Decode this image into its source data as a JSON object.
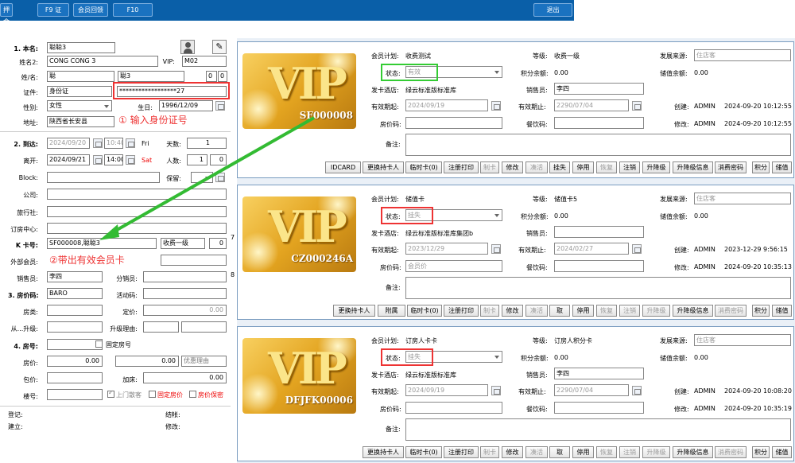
{
  "toolbar": {
    "btn1": "押金",
    "btn2": "F9 证",
    "btn3": "会员回馈",
    "btn4": "F10",
    "exit": "退出"
  },
  "left": {
    "name_label": "1. 本名:",
    "name_val": "聪聪3",
    "name2_label": "姓名2:",
    "name2_val": "CONG CONG 3",
    "vip_label": "VIP:",
    "vip_val": "M02",
    "surname_label": "姓/名:",
    "surname_val": "聪",
    "given_val": "聪3",
    "n1": "0",
    "n2": "0",
    "id_label": "证件:",
    "id_type": "身份证",
    "id_no": "******************27",
    "sex_label": "性别:",
    "sex_val": "女性",
    "birth_label": "生日:",
    "birth_val": "1996/12/09",
    "addr_label": "地址:",
    "addr_val": "陕西省长安县",
    "arrive_label": "2. 到达:",
    "arrive_date": "2024/09/20",
    "arrive_time": "10:40",
    "arrive_dow": "Fri",
    "days_label": "天数:",
    "days_val": "1",
    "leave_label": "离开:",
    "leave_date": "2024/09/21",
    "leave_time": "14:00",
    "leave_dow": "Sat",
    "people_label": "人数:",
    "people_val": "1",
    "people_val2": "0",
    "block_label": "Block:",
    "keep_label": "保留:",
    "company_label": "公司:",
    "agent_label": "旅行社:",
    "center_label": "订房中心:",
    "kcard_label": "K 卡号:",
    "kcard_val": "SF000008,聪聪3",
    "kcard_type": "收费一级",
    "kcard_n": "0",
    "ext_label": "外部会员:",
    "sales_label": "销售员:",
    "sales_val": "李四",
    "sub_label": "分销员:",
    "rate_label": "3. 房价码:",
    "rate_val": "BARO",
    "act_label": "活动码:",
    "rtype_label": "房类:",
    "price_label": "定价:",
    "price_val": "0.00",
    "from_label": "从...升级:",
    "upg_label": "升级理由:",
    "room_label": "4. 房号:",
    "fix_label": "固定房号",
    "rprice_label": "房价:",
    "rprice_val": "0.00",
    "rprice2": "0.00",
    "disc_label": "优惠理由",
    "pkg_label": "包价:",
    "add_label": "加床:",
    "add_val": "0.00",
    "stay_label": "楼号:",
    "door_label": "上门散客",
    "fixprice_label": "固定房价",
    "secret_label": "房价保密",
    "reg_label": "登记:",
    "settle_label": "结帐:",
    "create_label": "建立:",
    "modify_label": "修改:",
    "side7": "7",
    "side8": "8"
  },
  "annot": {
    "a1": "① 输入身份证号",
    "a2": "②带出有效会员卡"
  },
  "panels": [
    {
      "card_no": "SF000008",
      "plan_label": "会员计划:",
      "plan_val": "收费测试",
      "level_label": "等级:",
      "level_val": "收费一级",
      "src_label": "发展来源:",
      "src_val": "住店客",
      "status_label": "状态:",
      "status_val": "有效",
      "points_label": "积分余额:",
      "points_val": "0.00",
      "stored_label": "储值余额:",
      "stored_val": "0.00",
      "hotel_label": "发卡酒店:",
      "hotel_val": "绿云标准版标准库",
      "sales_label": "销售员:",
      "sales_val": "李四",
      "from_label": "有效期起:",
      "from_val": "2024/09/19",
      "to_label": "有效期止:",
      "to_val": "2290/07/04",
      "created_label": "创建:",
      "created_user": "ADMIN",
      "created_at": "2024-09-20 10:12:55",
      "room_label": "房价码:",
      "room_val": "",
      "meal_label": "餐饮码:",
      "modified_label": "修改:",
      "modified_user": "ADMIN",
      "modified_at": "2024-09-20 10:12:55",
      "note_label": "备注:",
      "buttons": [
        "IDCARD",
        "更换持卡人",
        "临时卡(0)",
        "注册打印",
        "制卡",
        "修改",
        "凑活",
        "挂失",
        "停用",
        "恢复",
        "注销",
        "升降级",
        "升降级信息",
        "消费密码",
        "积分",
        "储值"
      ],
      "disabled": [
        4,
        6,
        9
      ]
    },
    {
      "card_no": "CZ000246A",
      "plan_label": "会员计划:",
      "plan_val": "储值卡",
      "level_label": "等级:",
      "level_val": "储值卡5",
      "src_label": "发展来源:",
      "src_val": "住店客",
      "status_label": "状态:",
      "status_val": "挂失",
      "points_label": "积分余额:",
      "points_val": "0.00",
      "stored_label": "储值余额:",
      "stored_val": "0.00",
      "hotel_label": "发卡酒店:",
      "hotel_val": "绿云标准版标准库集团b",
      "sales_label": "销售员:",
      "sales_val": "",
      "from_label": "有效期起:",
      "from_val": "2023/12/29",
      "to_label": "有效期止:",
      "to_val": "2024/02/27",
      "created_label": "创建:",
      "created_user": "ADMIN",
      "created_at": "2023-12-29 9:56:15",
      "room_label": "房价码:",
      "room_val": "会员价",
      "meal_label": "餐饮码:",
      "modified_label": "修改:",
      "modified_user": "ADMIN",
      "modified_at": "2024-09-20 10:35:13",
      "note_label": "备注:",
      "buttons": [
        "更换持卡人",
        "附属",
        "临时卡(0)",
        "注册打印",
        "制卡",
        "修改",
        "凑活",
        "取",
        "停用",
        "恢复",
        "注销",
        "升降级",
        "升降级信息",
        "消费密码",
        "积分",
        "储值"
      ],
      "disabled": [
        4,
        6,
        9,
        10,
        11,
        13
      ]
    },
    {
      "card_no": "DFJFK00006",
      "plan_label": "会员计划:",
      "plan_val": "订房人卡卡",
      "level_label": "等级:",
      "level_val": "订房人积分卡",
      "src_label": "发展来源:",
      "src_val": "住店客",
      "status_label": "状态:",
      "status_val": "挂失",
      "points_label": "积分余额:",
      "points_val": "0.00",
      "stored_label": "储值余额:",
      "stored_val": "0.00",
      "hotel_label": "发卡酒店:",
      "hotel_val": "绿云标准版标准库",
      "sales_label": "销售员:",
      "sales_val": "李四",
      "from_label": "有效期起:",
      "from_val": "2024/09/19",
      "to_label": "有效期止:",
      "to_val": "2290/07/04",
      "created_label": "创建:",
      "created_user": "ADMIN",
      "created_at": "2024-09-20 10:08:20",
      "room_label": "房价码:",
      "room_val": "",
      "meal_label": "餐饮码:",
      "modified_label": "修改:",
      "modified_user": "ADMIN",
      "modified_at": "2024-09-20 10:35:19",
      "note_label": "备注:",
      "buttons": [
        "更换持卡人",
        "临时卡(0)",
        "注册打印",
        "制卡",
        "修改",
        "凑活",
        "取",
        "停用",
        "恢复",
        "注销",
        "升降级",
        "升降级信息",
        "消费密码",
        "积分",
        "储值"
      ],
      "disabled": [
        3,
        5,
        8,
        9,
        10,
        12
      ]
    }
  ],
  "colors": {
    "toolbar": "#0a5fa8",
    "annot": "#e33333",
    "arrow": "#33bb33"
  }
}
